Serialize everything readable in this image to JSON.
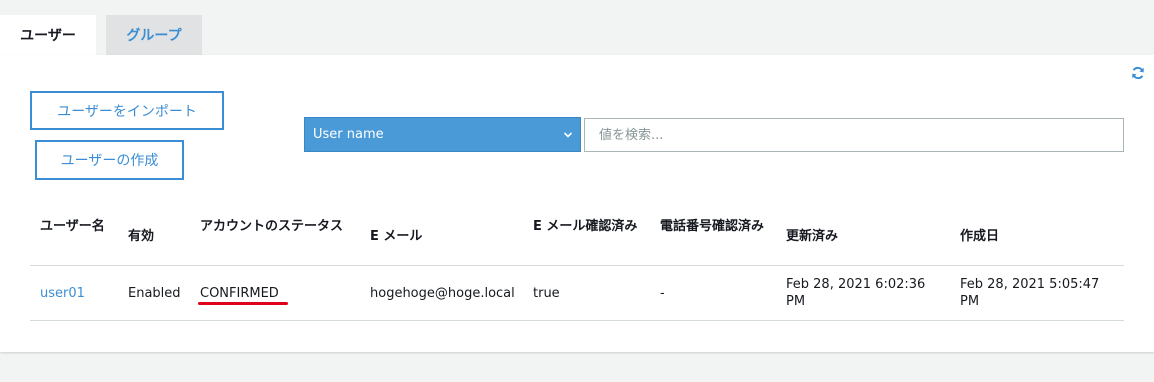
{
  "tabs": [
    {
      "label": "ユーザー",
      "active": true
    },
    {
      "label": "グループ",
      "active": false
    }
  ],
  "toolbar": {
    "refresh_icon": "refresh-icon",
    "import_label": "ユーザーをインポート",
    "create_label": "ユーザーの作成"
  },
  "filter": {
    "selected_attribute": "User name",
    "search_placeholder": "値を検索..."
  },
  "table": {
    "columns": [
      "ユーザー名",
      "有効",
      "アカウントのステータス",
      "E メール",
      "E メール確認済み",
      "電話番号確認済み",
      "更新済み",
      "作成日"
    ],
    "rows": [
      {
        "username": "user01",
        "enabled": "Enabled",
        "status": "CONFIRMED",
        "email": "hogehoge@hoge.local",
        "email_verified": "true",
        "phone_verified": "-",
        "updated": "Feb 28, 2021 6:02:36 PM",
        "created": "Feb 28, 2021 5:05:47 PM"
      }
    ]
  },
  "colors": {
    "accent": "#3b8ed3",
    "select_bg": "#4a9ad8",
    "annotation": "#e0001a"
  }
}
